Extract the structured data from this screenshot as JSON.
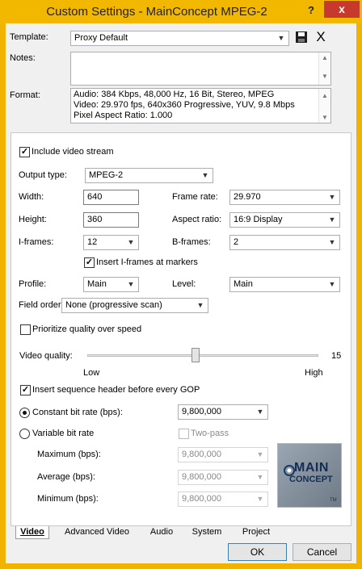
{
  "window": {
    "title": "Custom Settings - MainConcept MPEG-2",
    "help_label": "?",
    "close_label": "x",
    "accent_color": "#f2b800"
  },
  "header": {
    "template_label": "Template:",
    "template_value": "Proxy Default",
    "save_icon": "save-icon",
    "delete_icon": "delete-icon",
    "delete_glyph": "X",
    "notes_label": "Notes:",
    "notes_value": "",
    "format_label": "Format:",
    "format_lines": [
      "Audio: 384 Kbps, 48,000 Hz, 16 Bit, Stereo, MPEG",
      "Video: 29.970 fps, 640x360 Progressive, YUV, 9.8 Mbps",
      "Pixel Aspect Ratio: 1.000"
    ]
  },
  "video": {
    "include_stream_label": "Include video stream",
    "include_stream_checked": true,
    "output_type_label": "Output type:",
    "output_type_value": "MPEG-2",
    "width_label": "Width:",
    "width_value": "640",
    "height_label": "Height:",
    "height_value": "360",
    "frame_rate_label": "Frame rate:",
    "frame_rate_value": "29.970",
    "aspect_label": "Aspect ratio:",
    "aspect_value": "16:9 Display",
    "iframes_label": "I-frames:",
    "iframes_value": "12",
    "bframes_label": "B-frames:",
    "bframes_value": "2",
    "insert_iframes_label": "Insert I-frames at markers",
    "insert_iframes_checked": true,
    "profile_label": "Profile:",
    "profile_value": "Main",
    "level_label": "Level:",
    "level_value": "Main",
    "field_order_label": "Field order:",
    "field_order_value": "None (progressive scan)",
    "prioritize_label": "Prioritize quality over speed",
    "prioritize_checked": false,
    "quality_label": "Video quality:",
    "quality_value": "15",
    "quality_fraction": 0.47,
    "quality_low": "Low",
    "quality_high": "High",
    "seq_header_label": "Insert sequence header before every GOP",
    "seq_header_checked": true,
    "cbr_label": "Constant bit rate (bps):",
    "cbr_value": "9,800,000",
    "cbr_selected": true,
    "vbr_label": "Variable bit rate",
    "two_pass_label": "Two-pass",
    "maximum_label": "Maximum (bps):",
    "maximum_value": "9,800,000",
    "average_label": "Average (bps):",
    "average_value": "9,800,000",
    "minimum_label": "Minimum (bps):",
    "minimum_value": "9,800,000",
    "logo_line1": "MAIN",
    "logo_line2": "CONCEPT",
    "logo_tm": "TM"
  },
  "tabs": [
    "Video",
    "Advanced Video",
    "Audio",
    "System",
    "Project"
  ],
  "footer": {
    "ok_label": "OK",
    "cancel_label": "Cancel"
  }
}
